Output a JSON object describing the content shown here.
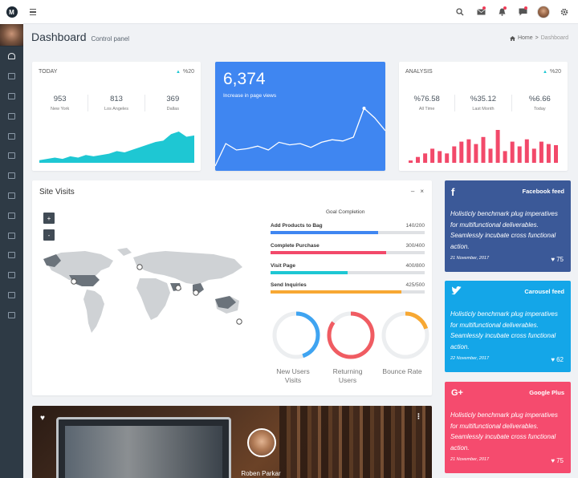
{
  "header": {
    "logo": "M",
    "icons": [
      "search-icon",
      "mail-icon",
      "bell-icon",
      "chat-icon",
      "user-avatar",
      "gear-icon"
    ]
  },
  "sidebar": {
    "items": [
      "dashboard-icon",
      "grid-icon",
      "mail-icon",
      "laptop-icon",
      "layers-icon",
      "square-icon",
      "palette-icon",
      "edit-icon",
      "table-icon",
      "envelope-open-icon",
      "map-icon",
      "plug-icon",
      "file-icon",
      "share-icon"
    ]
  },
  "page": {
    "title": "Dashboard",
    "subtitle": "Control panel",
    "breadcrumb": {
      "home": "Home",
      "separator": ">",
      "current": "Dashboard"
    }
  },
  "today_card": {
    "title": "TODAY",
    "change": "%20",
    "stats": [
      {
        "value": "953",
        "label": "New York"
      },
      {
        "value": "813",
        "label": "Los Angeles"
      },
      {
        "value": "369",
        "label": "Dallas"
      }
    ],
    "sparkline": [
      2,
      3,
      4,
      3,
      5,
      4,
      6,
      5,
      6,
      7,
      9,
      8,
      10,
      12,
      14,
      16,
      17,
      22,
      24,
      20,
      21
    ],
    "color": "#1ec7d3"
  },
  "views_card": {
    "value": "6,374",
    "label": "Increase in page views",
    "line": [
      5,
      40,
      30,
      32,
      36,
      30,
      42,
      38,
      40,
      34,
      42,
      46,
      44,
      50,
      95,
      80,
      60
    ],
    "color": "#3f86f1"
  },
  "analysis_card": {
    "title": "ANALYSIS",
    "change": "%20",
    "stats": [
      {
        "value": "%76.58",
        "label": "All Time"
      },
      {
        "value": "%35.12",
        "label": "Last Month"
      },
      {
        "value": "%6.66",
        "label": "Today"
      }
    ],
    "bars": [
      2,
      5,
      8,
      12,
      10,
      8,
      14,
      18,
      20,
      16,
      22,
      12,
      28,
      10,
      18,
      14,
      20,
      12,
      18,
      16,
      15
    ],
    "color": "#f2496a"
  },
  "site_visits": {
    "title": "Site Visits",
    "zoom_in": "+",
    "zoom_out": "-",
    "minimize": "‒",
    "close": "×",
    "goal_title": "Goal Completion",
    "goals": [
      {
        "label": "Add Products to Bag",
        "value": "140",
        "total": "/200",
        "fraction": 0.7,
        "color": "#3f86f1"
      },
      {
        "label": "Complete Purchase",
        "value": "300",
        "total": "/400",
        "fraction": 0.75,
        "color": "#f2496a"
      },
      {
        "label": "Visit Page",
        "value": "400",
        "total": "/800",
        "fraction": 0.5,
        "color": "#1ec7d3"
      },
      {
        "label": "Send Inquiries",
        "value": "425",
        "total": "/500",
        "fraction": 0.85,
        "color": "#f7a833"
      }
    ],
    "donuts": [
      {
        "label": "New Users Visits",
        "fraction": 0.45,
        "color": "#3fa4f1"
      },
      {
        "label": "Returning Users",
        "fraction": 0.85,
        "color": "#f05c62"
      },
      {
        "label": "Bounce Rate",
        "fraction": 0.2,
        "color": "#f7a833"
      }
    ]
  },
  "social": [
    {
      "name": "Facebook feed",
      "icon": "f",
      "icon_name": "facebook-icon",
      "text": "Holisticly benchmark plug imperatives for multifunctional deliverables. Seamlessly incubate cross functional action.",
      "date": "21 November, 2017",
      "likes": "75",
      "color": "#3b5998"
    },
    {
      "name": "Carousel feed",
      "icon": "🐦",
      "icon_name": "twitter-icon",
      "text": "Holisticly benchmark plug imperatives for multifunctional deliverables. Seamlessly incubate cross functional action.",
      "date": "22 November, 2017",
      "likes": "62",
      "color": "#14a6e8"
    },
    {
      "name": "Google Plus",
      "icon": "G+",
      "icon_name": "google-plus-icon",
      "text": "Holisticly benchmark plug imperatives for multifunctional deliverables. Seamlessly incubate cross functional action.",
      "date": "21 November, 2017",
      "likes": "75",
      "color": "#f54b6e"
    }
  ],
  "profile_card": {
    "name": "Roben Parkar",
    "menu": "⋮",
    "heart": "♥"
  }
}
